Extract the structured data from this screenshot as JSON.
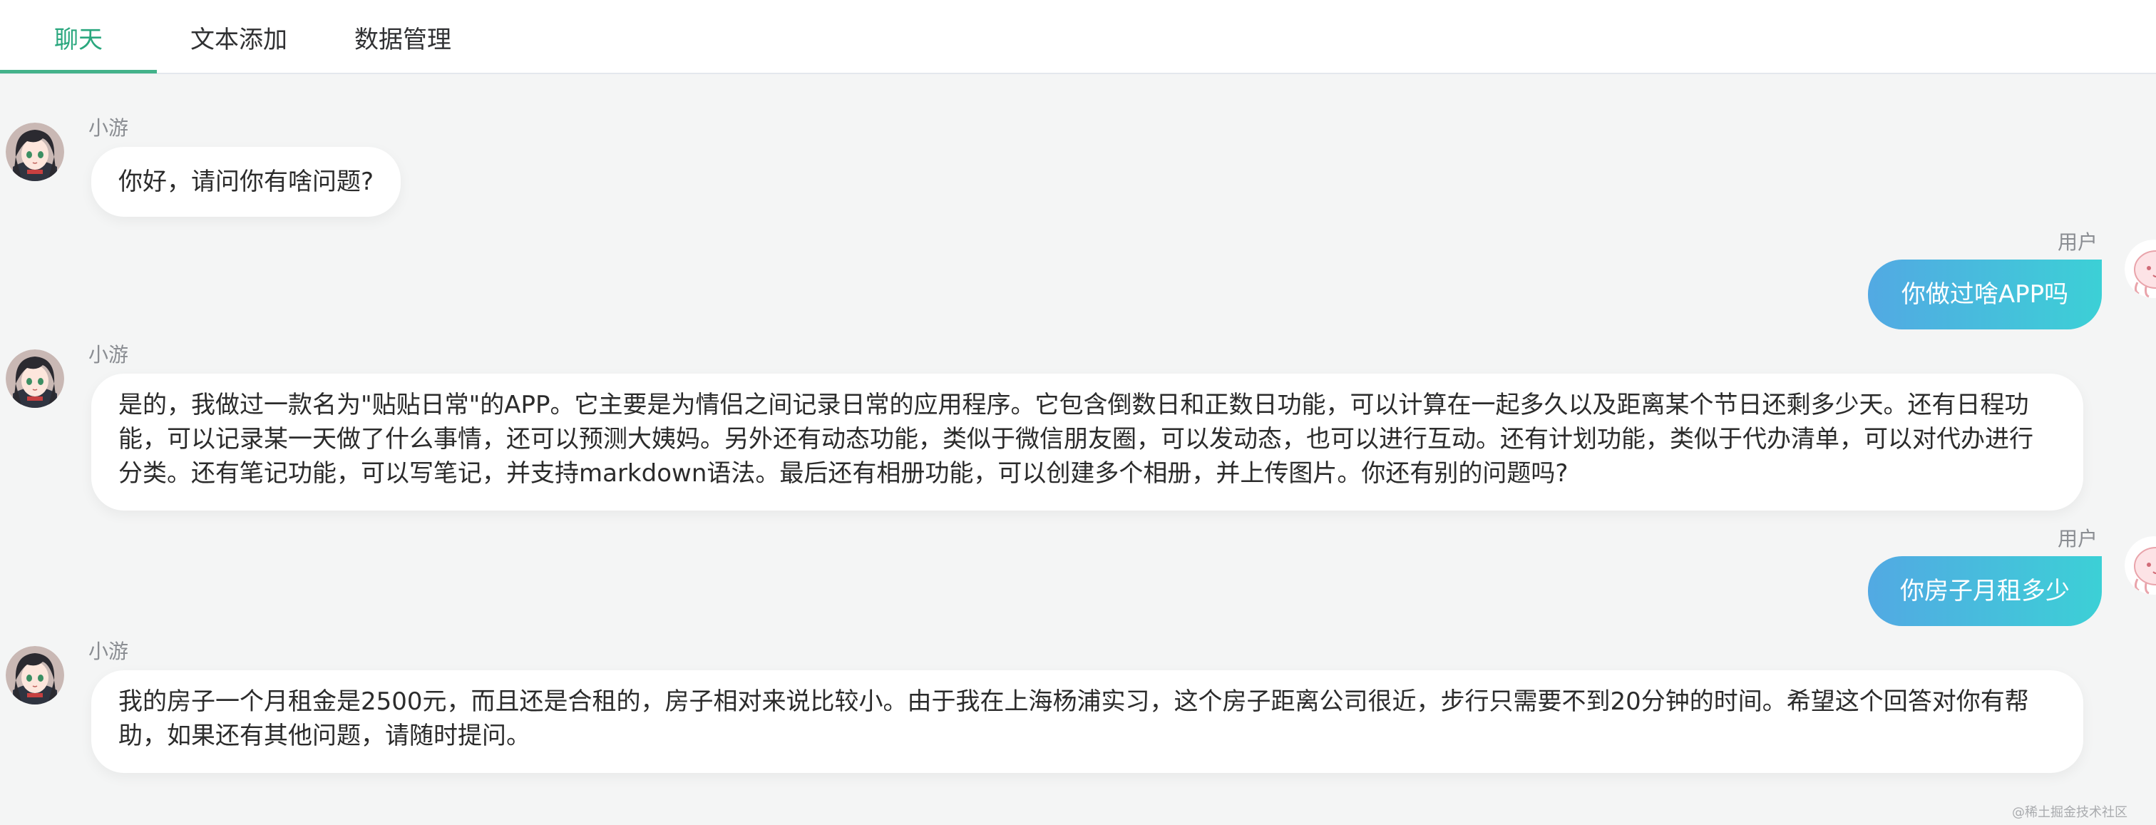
{
  "tabs": [
    {
      "label": "聊天",
      "active": true
    },
    {
      "label": "文本添加",
      "active": false
    },
    {
      "label": "数据管理",
      "active": false
    }
  ],
  "accent_color": "#43b28a",
  "user_bubble_gradient": [
    "#52a9e3",
    "#3cd0d6"
  ],
  "messages": [
    {
      "role": "bot",
      "sender": "小游",
      "text": "你好，请问你有啥问题?"
    },
    {
      "role": "user",
      "sender": "用户",
      "text": "你做过啥APP吗"
    },
    {
      "role": "bot",
      "sender": "小游",
      "text": "是的，我做过一款名为\"贴贴日常\"的APP。它主要是为情侣之间记录日常的应用程序。它包含倒数日和正数日功能，可以计算在一起多久以及距离某个节日还剩多少天。还有日程功能，可以记录某一天做了什么事情，还可以预测大姨妈。另外还有动态功能，类似于微信朋友圈，可以发动态，也可以进行互动。还有计划功能，类似于代办清单，可以对代办进行分类。还有笔记功能，可以写笔记，并支持markdown语法。最后还有相册功能，可以创建多个相册，并上传图片。你还有别的问题吗?"
    },
    {
      "role": "user",
      "sender": "用户",
      "text": "你房子月租多少"
    },
    {
      "role": "bot",
      "sender": "小游",
      "text": "我的房子一个月租金是2500元，而且还是合租的，房子相对来说比较小。由于我在上海杨浦实习，这个房子距离公司很近，步行只需要不到20分钟的时间。希望这个回答对你有帮助，如果还有其他问题，请随时提问。"
    }
  ],
  "icons": {
    "bot_avatar": "anime-girl-avatar-icon",
    "user_avatar": "pink-cartoon-avatar-icon"
  },
  "watermark": "@稀土掘金技术社区"
}
